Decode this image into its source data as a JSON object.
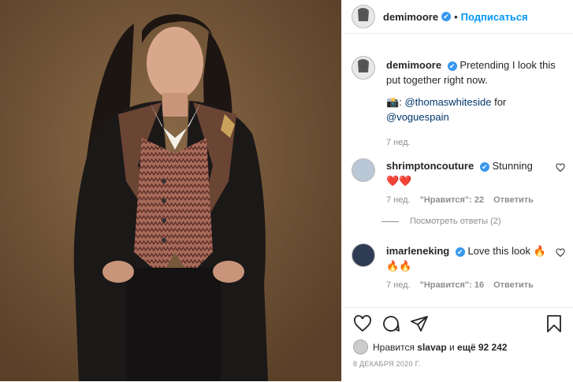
{
  "header": {
    "username": "demimoore",
    "verified_glyph": "✔",
    "separator": "•",
    "follow_label": "Подписаться"
  },
  "caption": {
    "username": "demimoore",
    "text": "Pretending I look this put together right now.",
    "camera_emoji": "📸",
    "credit_colon": ":",
    "credit_user": "@thomaswhiteside",
    "credit_for": "for",
    "credit_target": "@voguespain",
    "time": "7 нед."
  },
  "comments": [
    {
      "username": "shrimptoncouture",
      "text": "Stunning",
      "emoji": "❤️❤️",
      "time": "7 нед.",
      "likes": "\"Нравится\": 22",
      "reply": "Ответить"
    },
    {
      "username": "imarleneking",
      "text": "Love this look",
      "emoji_inline": "🔥",
      "emoji": "🔥🔥",
      "time": "7 нед.",
      "likes": "\"Нравится\": 16",
      "reply": "Ответить"
    }
  ],
  "view_replies": "Посмотреть ответы (2)",
  "likes": {
    "prefix": "Нравится",
    "user": "slavap",
    "middle": "и",
    "count": "ещё 92 242"
  },
  "date": "8 ДЕКАБРЯ 2020 Г.",
  "icons": {
    "like": "heart-icon",
    "comment": "comment-icon",
    "share": "share-icon",
    "save": "bookmark-icon"
  },
  "colors": {
    "accent": "#0095f6",
    "verified": "#3897f0",
    "muted": "#8e8e8e",
    "photo_bg": "#7a5c3f"
  }
}
